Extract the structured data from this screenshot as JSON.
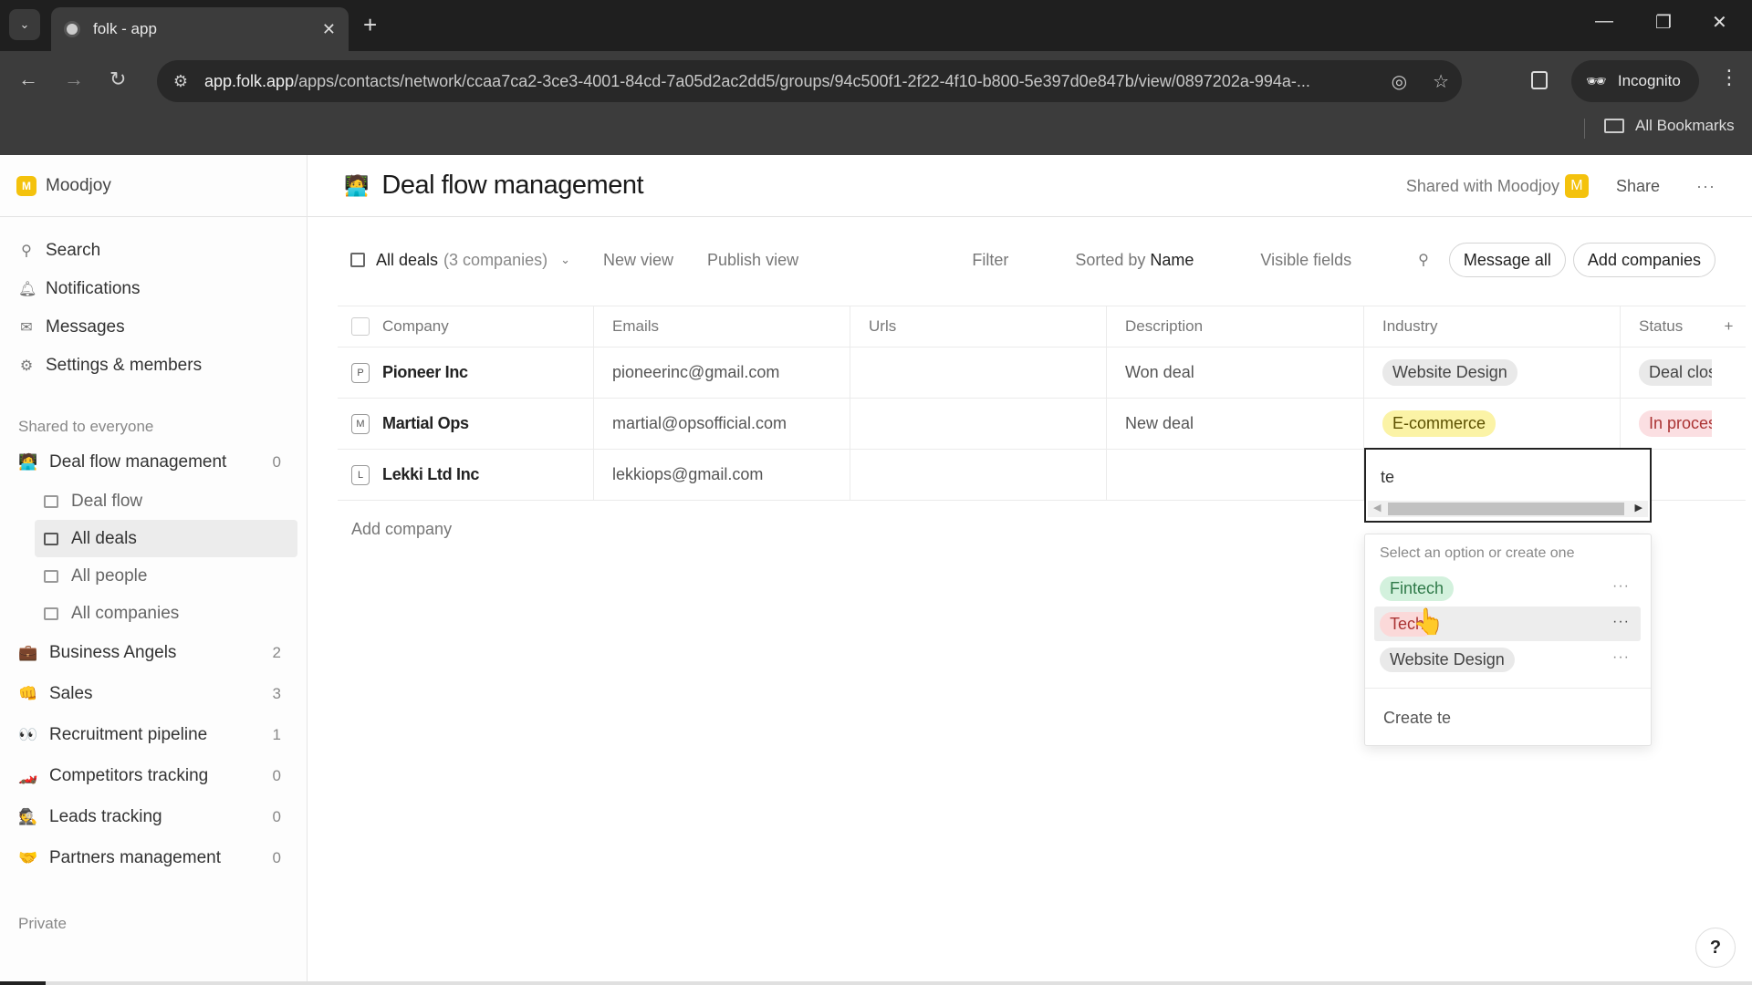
{
  "browser": {
    "tab_title": "folk - app",
    "url_host": "app.folk.app",
    "url_path": "/apps/contacts/network/ccaa7ca2-3ce3-4001-84cd-7a05d2ac2dd5/groups/94c500f1-2f22-4f10-b800-5e397d0e847b/view/0897202a-994a-...",
    "incognito_label": "Incognito",
    "bookmarks_label": "All Bookmarks"
  },
  "workspace": {
    "name": "Moodjoy",
    "badge": "M"
  },
  "sidebar": {
    "nav": [
      {
        "label": "Search",
        "icon": "search-icon"
      },
      {
        "label": "Notifications",
        "icon": "bell-icon"
      },
      {
        "label": "Messages",
        "icon": "mail-icon"
      },
      {
        "label": "Settings & members",
        "icon": "gear-icon"
      }
    ],
    "shared_heading": "Shared to everyone",
    "groups": [
      {
        "label": "Deal flow management",
        "emoji": "🧑‍💻",
        "count": "0"
      },
      {
        "label": "Business Angels",
        "emoji": "💼",
        "count": "2"
      },
      {
        "label": "Sales",
        "emoji": "👊",
        "count": "3"
      },
      {
        "label": "Recruitment pipeline",
        "emoji": "👀",
        "count": "1"
      },
      {
        "label": "Competitors tracking",
        "emoji": "🏎️",
        "count": "0"
      },
      {
        "label": "Leads tracking",
        "emoji": "🕵️",
        "count": "0"
      },
      {
        "label": "Partners management",
        "emoji": "🤝",
        "count": "0"
      }
    ],
    "views": [
      {
        "label": "Deal flow",
        "active": false
      },
      {
        "label": "All deals",
        "active": true
      },
      {
        "label": "All people",
        "active": false
      },
      {
        "label": "All companies",
        "active": false
      }
    ],
    "private_heading": "Private"
  },
  "header": {
    "emoji": "🧑‍💻",
    "title": "Deal flow management",
    "shared_with": "Shared with Moodjoy",
    "shared_badge": "M",
    "share_label": "Share",
    "more_label": "···"
  },
  "toolbar": {
    "view_name": "All deals",
    "view_count": "(3 companies)",
    "new_view": "New view",
    "publish_view": "Publish view",
    "filter": "Filter",
    "sorted_prefix": "Sorted by",
    "sorted_field": "Name",
    "visible_fields": "Visible fields",
    "message_all": "Message all",
    "add_companies": "Add companies"
  },
  "table": {
    "columns": [
      "Company",
      "Emails",
      "Urls",
      "Description",
      "Industry",
      "Status"
    ],
    "add_column": "+",
    "rows": [
      {
        "letter": "P",
        "company": "Pioneer Inc",
        "email": "pioneerinc@gmail.com",
        "url": "",
        "description": "Won deal",
        "industry": "Website Design",
        "status": "Deal closed"
      },
      {
        "letter": "M",
        "company": "Martial Ops",
        "email": "martial@opsofficial.com",
        "url": "",
        "description": "New deal",
        "industry": "E-commerce",
        "status": "In process"
      },
      {
        "letter": "L",
        "company": "Lekki Ltd Inc",
        "email": "lekkiops@gmail.com",
        "url": "",
        "description": "",
        "industry": "",
        "status": ""
      }
    ],
    "add_company": "Add company"
  },
  "colors": {
    "industry": {
      "Website Design": "#e9e9e9",
      "E-commerce": "#fbf3a6",
      "Fintech": "#d3f1dd",
      "Tech": "#fbd9d9"
    },
    "status": {
      "Deal closed": "#e9e9e9",
      "In process": "#fbdfe2"
    },
    "accent": "#f4c20d"
  },
  "industry_editor": {
    "value": "te",
    "hint": "Select an option or create one",
    "options": [
      {
        "label": "Fintech",
        "color": "#d3f1dd",
        "text": "#2f7a49"
      },
      {
        "label": "Tech",
        "color": "#fbd9d9",
        "text": "#a33"
      },
      {
        "label": "Website Design",
        "color": "#e9e9e9",
        "text": "#444"
      }
    ],
    "create_label": "Create te"
  },
  "help_label": "?"
}
